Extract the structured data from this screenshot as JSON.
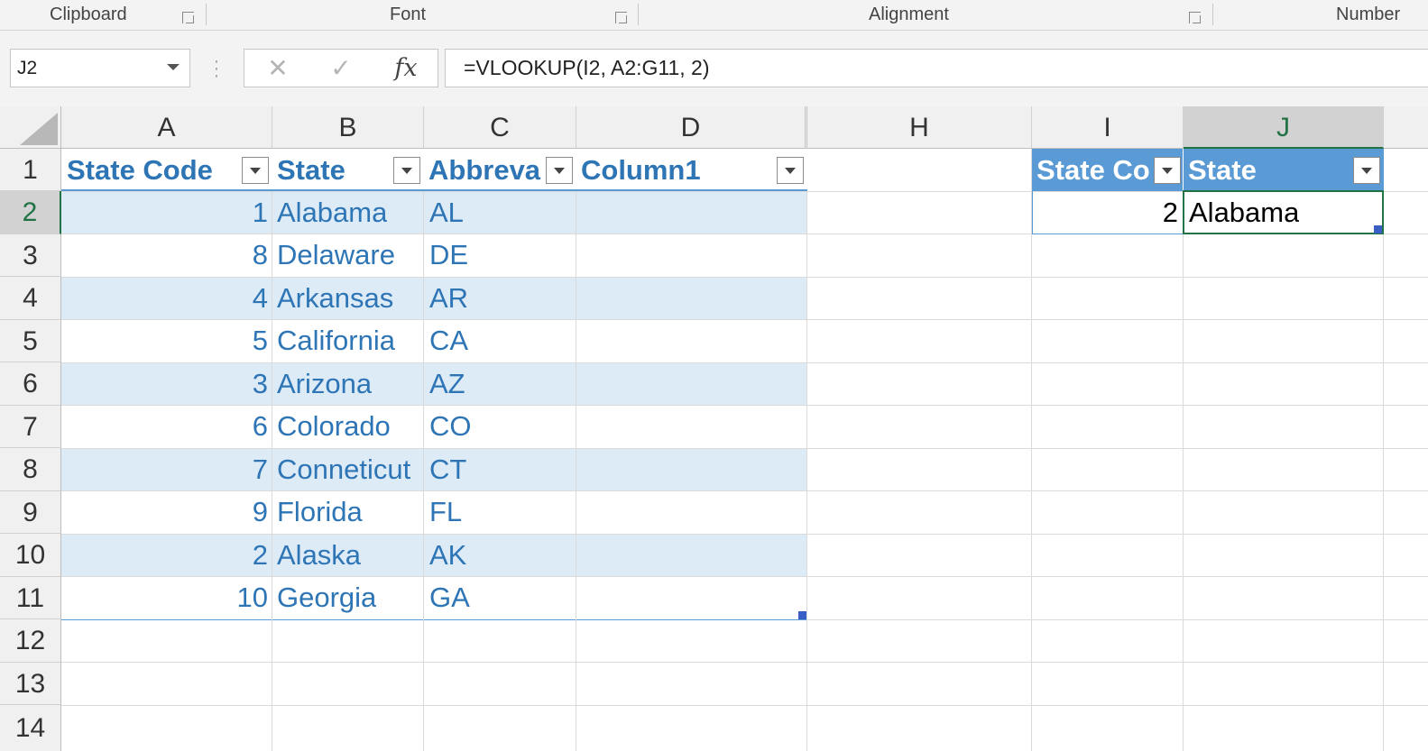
{
  "ribbon": {
    "groups": [
      "Clipboard",
      "Font",
      "Alignment",
      "Number"
    ]
  },
  "formula_bar": {
    "name_box": "J2",
    "cancel_icon": "✕",
    "enter_icon": "✓",
    "fx_label": "fx",
    "formula": "=VLOOKUP(I2, A2:G11, 2)"
  },
  "columns": [
    "A",
    "B",
    "C",
    "D",
    "H",
    "I",
    "J"
  ],
  "rows": [
    "1",
    "2",
    "3",
    "4",
    "5",
    "6",
    "7",
    "8",
    "9",
    "10",
    "11",
    "12",
    "13",
    "14"
  ],
  "table1": {
    "headers": [
      "State Code",
      "State",
      "Abbreva",
      "Column1"
    ],
    "rows": [
      {
        "code": "1",
        "state": "Alabama",
        "abbr": "AL"
      },
      {
        "code": "8",
        "state": "Delaware",
        "abbr": "DE"
      },
      {
        "code": "4",
        "state": "Arkansas",
        "abbr": "AR"
      },
      {
        "code": "5",
        "state": "California",
        "abbr": "CA"
      },
      {
        "code": "3",
        "state": "Arizona",
        "abbr": "AZ"
      },
      {
        "code": "6",
        "state": "Colorado",
        "abbr": "CO"
      },
      {
        "code": "7",
        "state": "Conneticut",
        "abbr": "CT"
      },
      {
        "code": "9",
        "state": "Florida",
        "abbr": "FL"
      },
      {
        "code": "2",
        "state": "Alaska",
        "abbr": "AK"
      },
      {
        "code": "10",
        "state": "Georgia",
        "abbr": "GA"
      }
    ]
  },
  "table2": {
    "headers": [
      "State Co",
      "State"
    ],
    "row": {
      "code": "2",
      "state": "Alabama"
    }
  },
  "colors": {
    "accent": "#2e75b6",
    "header_fill": "#5b9bd5",
    "band_fill": "#ddebf7",
    "excel_green": "#217346"
  }
}
